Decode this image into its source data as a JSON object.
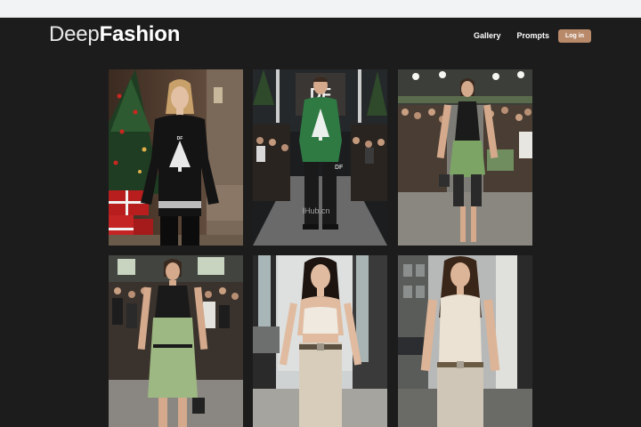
{
  "logo": {
    "light": "Deep",
    "bold": "Fashion"
  },
  "nav": {
    "gallery": "Gallery",
    "prompts": "Prompts",
    "login": "Log in"
  },
  "cards": [
    {
      "alt": "Model in black Christmas-tree sweater beside a decorated tree and gift boxes",
      "shirt_text": "DF"
    },
    {
      "alt": "Male model in green tree-print sweater on runway",
      "backdrop_text": "DF"
    },
    {
      "alt": "Model in green dress with black lace halter walking runway"
    },
    {
      "alt": "Model in sage green dress with lace halter at fashion show"
    },
    {
      "alt": "Model in cream crop top and beige trousers on city street"
    },
    {
      "alt": "Model in beige tank top and belted trousers on street"
    }
  ],
  "watermark": "lHub.cn"
}
